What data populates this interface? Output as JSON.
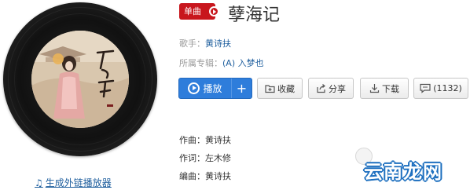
{
  "song": {
    "badge": "单曲",
    "title": "孽海记"
  },
  "meta": {
    "singer_label": "歌手：",
    "singer": "黄诗扶",
    "album_label": "所属专辑：",
    "album": "(A) 入梦也"
  },
  "actions": {
    "play": "播放",
    "add": "+",
    "collect": "收藏",
    "share": "分享",
    "download": "下载",
    "comments": "(1132)"
  },
  "credits": {
    "composer_label": "作曲：",
    "composer": "黄诗扶",
    "lyricist_label": "作词：",
    "lyricist": "左木修",
    "arranger_label": "编曲：",
    "arranger": "黄诗扶"
  },
  "player_link": {
    "icon": "music-note-icon",
    "label": "生成外链播放器"
  },
  "watermark": {
    "text": "云南龙网"
  },
  "colors": {
    "badge": "#c8161d",
    "play_button": "#2e7ddb",
    "link": "#1f5f9e",
    "watermark": "#1d6fbf"
  }
}
